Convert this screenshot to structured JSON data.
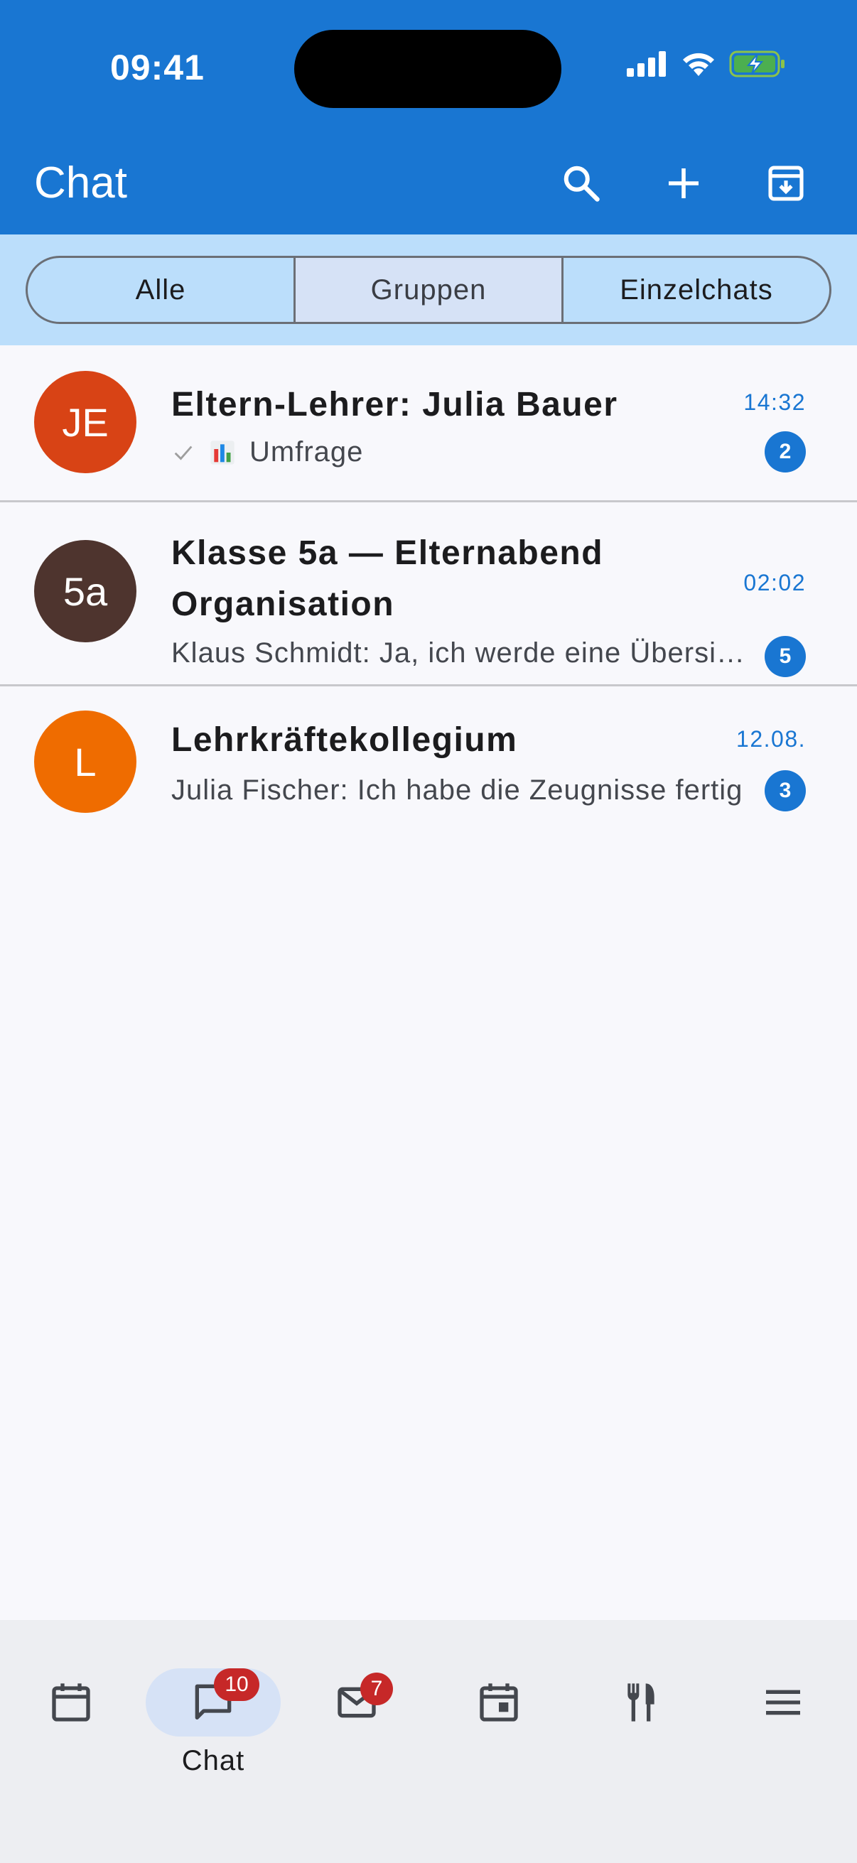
{
  "status_bar": {
    "time": "09:41"
  },
  "header": {
    "title": "Chat"
  },
  "segments": [
    {
      "label": "Alle"
    },
    {
      "label": "Gruppen"
    },
    {
      "label": "Einzelchats"
    }
  ],
  "chats": [
    {
      "avatar_initials": "JE",
      "avatar_color": "#d84315",
      "name": "Eltern-Lehrer: Julia Bauer",
      "preview": "Umfrage",
      "time": "14:32",
      "unread": "2"
    },
    {
      "avatar_initials": "5a",
      "avatar_color": "#4e342e",
      "name": "Klasse 5a — Elternabend Organisation",
      "preview": "Klaus Schmidt: Ja, ich werde eine Übersicht erstellen",
      "time": "02:02",
      "unread": "5"
    },
    {
      "avatar_initials": "L",
      "avatar_color": "#ef6c00",
      "name": "Lehrkräftekollegium",
      "preview": "Julia Fischer: Ich habe die Zeugnisse fertig",
      "time": "12.08.",
      "unread": "3"
    }
  ],
  "bottom_nav": {
    "chat_label": "Chat",
    "chat_badge": "10",
    "mail_badge": "7"
  },
  "colors": {
    "primary": "#1976d2",
    "segment_bg": "#bbdefb",
    "badge_red": "#c62828"
  }
}
